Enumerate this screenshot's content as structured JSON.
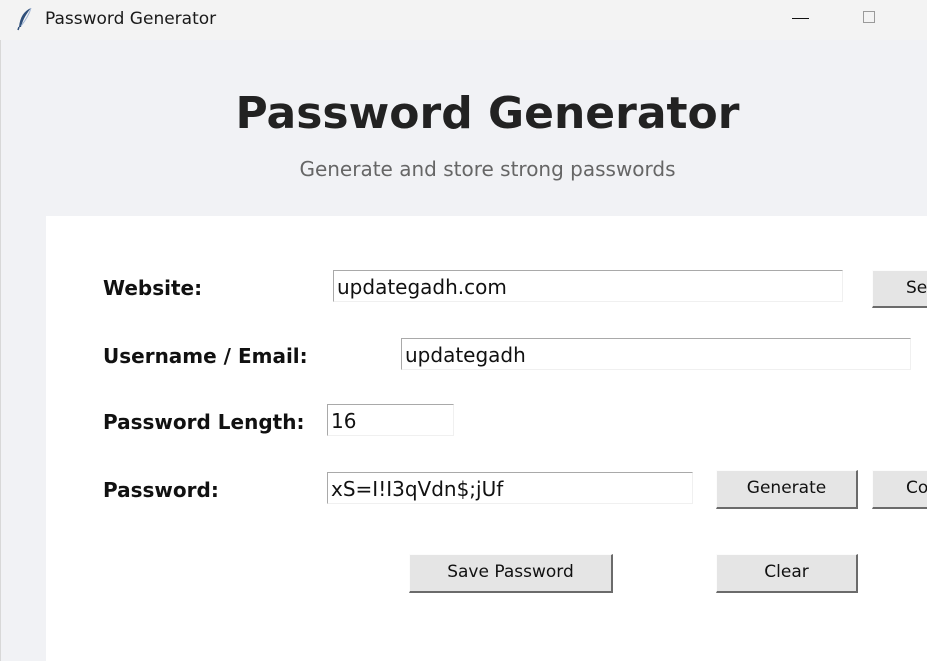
{
  "window": {
    "title": "Password Generator",
    "icon": "feather-icon"
  },
  "header": {
    "title": "Password Generator",
    "subtitle": "Generate and store strong passwords"
  },
  "form": {
    "website": {
      "label": "Website:",
      "value": "updategadh.com"
    },
    "username": {
      "label": "Username / Email:",
      "value": "updategadh"
    },
    "length": {
      "label": "Password Length:",
      "value": "16"
    },
    "password": {
      "label": "Password:",
      "value": "xS=I!I3qVdn$;jUf"
    }
  },
  "buttons": {
    "search": "Sea",
    "generate": "Generate",
    "copy": "Co",
    "save": "Save Password",
    "clear": "Clear"
  },
  "colors": {
    "window_bg": "#f1f2f5",
    "card_bg": "#ffffff",
    "button_bg": "#e5e5e5",
    "title_text": "#222222",
    "subtitle_text": "#666666"
  }
}
